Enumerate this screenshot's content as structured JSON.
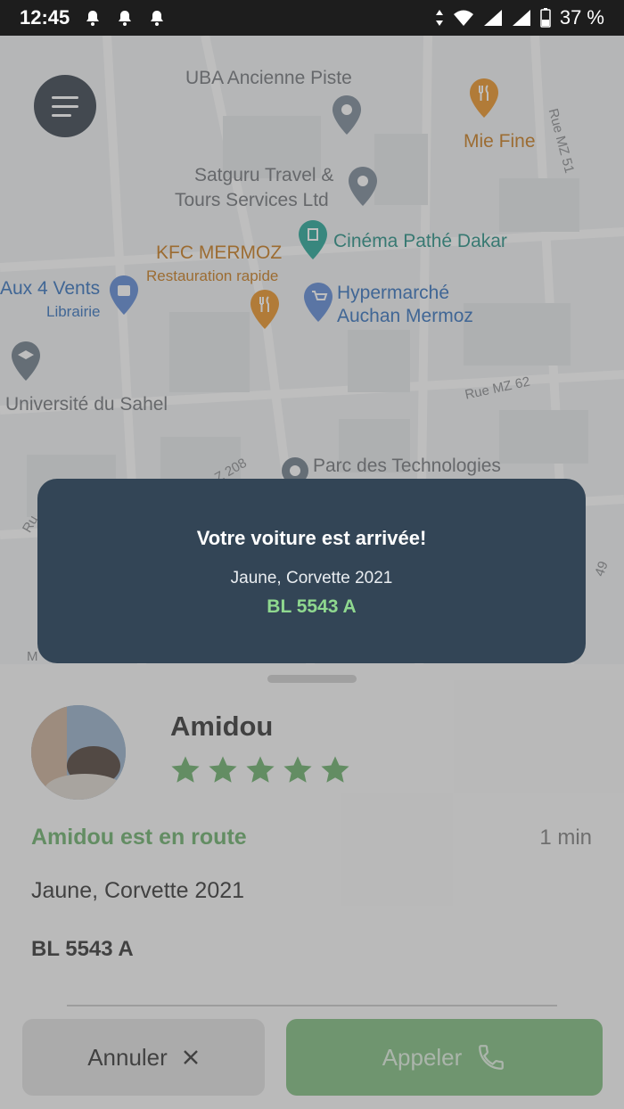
{
  "status_bar": {
    "time": "12:45",
    "battery": "37 %",
    "icons": [
      "bell-icon",
      "bell-icon",
      "bell-icon",
      "data-arrows-icon",
      "wifi-icon",
      "signal-icon",
      "signal-icon",
      "battery-icon"
    ]
  },
  "map": {
    "pois": {
      "uba": "UBA Ancienne Piste",
      "mie_fine": "Mie Fine",
      "satguru_1": "Satguru Travel &",
      "satguru_2": "Tours Services Ltd",
      "cinema": "Cinéma Pathé Dakar",
      "kfc": "KFC MERMOZ",
      "kfc_sub": "Restauration rapide",
      "aux4vents": "Aux 4 Vents",
      "aux4vents_sub": "Librairie",
      "hypermarche_1": "Hypermarché",
      "hypermarche_2": "Auchan Mermoz",
      "universite": "Université du Sahel",
      "parc": "Parc des Technologies"
    },
    "streets": {
      "rue_mz51": "Rue MZ 51",
      "rue_mz62": "Rue MZ 62",
      "mz208": "Z 208",
      "ru": "Ru",
      "n49": "49",
      "m": "M"
    }
  },
  "toast": {
    "title": "Votre voiture est arrivée!",
    "car": "Jaune, Corvette 2021",
    "plate": "BL 5543 A"
  },
  "driver": {
    "name": "Amidou",
    "rating": 5,
    "rating_max": 5,
    "status": "Amidou est en route",
    "eta": "1 min",
    "car": "Jaune, Corvette 2021",
    "plate": "BL 5543 A"
  },
  "actions": {
    "cancel_label": "Annuler",
    "call_label": "Appeler"
  },
  "colors": {
    "accent_green": "#6fb46f",
    "toast_bg": "#334556",
    "plate_green": "#8fd88f"
  }
}
